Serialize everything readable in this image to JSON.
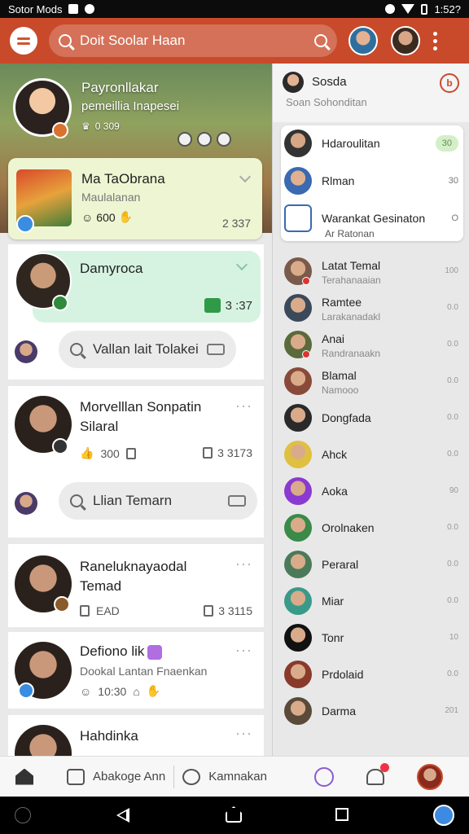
{
  "status_bar": {
    "left_text": "Sotor Mods",
    "time": "1:52?"
  },
  "app_bar": {
    "search_text": "Doit Soolar Haan"
  },
  "profile": {
    "name": "Payronllakar",
    "subtitle": "pemeillia Inapesei",
    "stats": "0 309"
  },
  "featured": {
    "title": "Ma TaObrana",
    "subtitle": "Maulalanan",
    "meta": "600",
    "count": "2 337"
  },
  "chat_card": {
    "title": "Damyroca",
    "count": "3 :37"
  },
  "pills": [
    {
      "text": "Vallan lait Tolakei"
    },
    {
      "text": "Llian Temarn"
    }
  ],
  "posts": [
    {
      "title": "Morvelllan Sonpatin",
      "title2": "Silaral",
      "meta": "300",
      "count": "3 3173",
      "dots": "···"
    },
    {
      "title": "Raneluknayaodal",
      "title2": "Temad",
      "meta": "EAD",
      "count": "3 3115",
      "dots": "···"
    },
    {
      "title": "Defiono lik",
      "title2": "Dookal Lantan Fnaenkan",
      "meta": "10:30",
      "dots": "···"
    },
    {
      "title": "Hahdinka",
      "dots": "···"
    }
  ],
  "right_panel": {
    "header_name": "Sosda",
    "header_sub": "Soan Sohonditan",
    "box": [
      {
        "name": "Hdaroulitan",
        "meta": "30"
      },
      {
        "name": "Rlman",
        "meta": "30"
      },
      {
        "name": "Warankat Gesinaton",
        "meta": "O"
      }
    ],
    "box_sub": "Ar Ratonan",
    "contacts": [
      {
        "name": "Latat Temal",
        "sub": "Terahanaaian",
        "time": "100",
        "color": "#7a5a4a",
        "dot": true
      },
      {
        "name": "Ramtee",
        "sub": "Larakanadakl",
        "time": "0.0",
        "color": "#3a4a5a",
        "dot": false
      },
      {
        "name": "Anai",
        "sub": "Randranaakn",
        "time": "0.0",
        "color": "#5a6a3a",
        "dot": true
      },
      {
        "name": "Blamal",
        "sub": "Namooo",
        "time": "0.0",
        "color": "#8a4a3a",
        "dot": false
      },
      {
        "name": "Dongfada",
        "sub": "",
        "time": "0.0",
        "color": "#2a2a2a",
        "dot": false
      },
      {
        "name": "Ahck",
        "sub": "",
        "time": "0.0",
        "color": "#e0c040",
        "dot": false
      },
      {
        "name": "Aoka",
        "sub": "",
        "time": "90",
        "color": "#8a3ad0",
        "dot": false
      },
      {
        "name": "Orolnaken",
        "sub": "",
        "time": "0.0",
        "color": "#3a8a4a",
        "dot": false
      },
      {
        "name": "Peraral",
        "sub": "",
        "time": "0.0",
        "color": "#4a7a5a",
        "dot": false
      },
      {
        "name": "Miar",
        "sub": "",
        "time": "0.0",
        "color": "#3a9a8a",
        "dot": false
      },
      {
        "name": "Tonr",
        "sub": "",
        "time": "10",
        "color": "#111111",
        "dot": false
      },
      {
        "name": "Prdolaid",
        "sub": "",
        "time": "0.0",
        "color": "#8a3a2a",
        "dot": false
      },
      {
        "name": "Darma",
        "sub": "",
        "time": "201",
        "color": "#5a4a3a",
        "dot": false
      }
    ]
  },
  "bottom_nav": {
    "tab1": "Abakoge Ann",
    "tab2": "Kamnakan"
  },
  "colors": {
    "brand": "#c84a2a",
    "featured_bg": "#eef5d2",
    "chat_bg": "#d6f3e2"
  }
}
